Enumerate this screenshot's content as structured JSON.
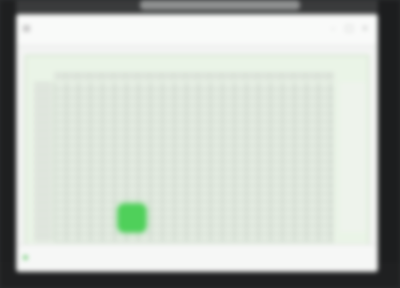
{
  "window": {
    "title": "",
    "controls": {
      "minimize": "–",
      "maximize": "□",
      "close": "×"
    }
  },
  "tabs": [],
  "sheet": {
    "selected_cell_color": "#4fd05a",
    "area_tint": "#eaf4e7"
  },
  "status": {
    "left_text": "",
    "zoom": ""
  },
  "icons": [
    "app-icon"
  ]
}
